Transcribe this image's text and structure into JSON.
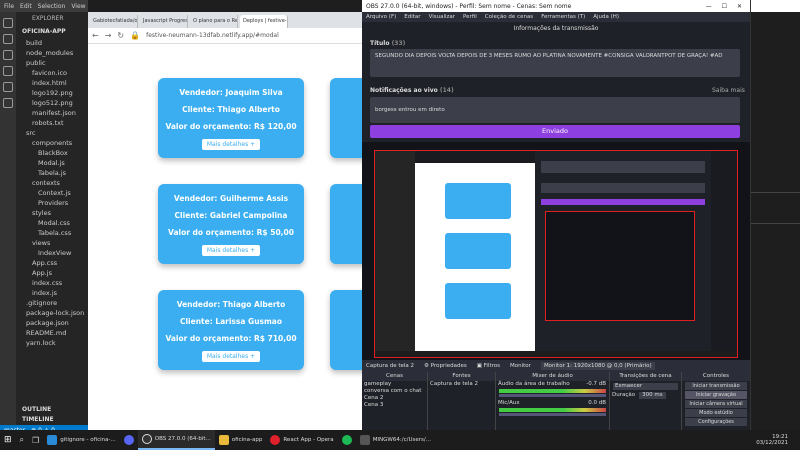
{
  "vscode": {
    "menu": [
      "File",
      "Edit",
      "Selection",
      "View"
    ],
    "explorer_header": "EXPLORER",
    "project": "OFICINA-APP",
    "tree": [
      "build",
      "node_modules",
      "public",
      "favicon.ico",
      "index.html",
      "logo192.png",
      "logo512.png",
      "manifest.json",
      "robots.txt",
      "src",
      "components",
      "BlackBox",
      "Modal.js",
      "Tabela.js",
      "contexts",
      "Context.js",
      "Providers",
      "styles",
      "Modal.css",
      "Tabela.css",
      "views",
      "IndexView",
      "App.css",
      "App.js",
      "index.css",
      "index.js",
      ".gitignore",
      "package-lock.json",
      "package.json",
      "README.md",
      "yarn.lock"
    ],
    "outline": "OUTLINE",
    "timeline": "TIMELINE",
    "status_branch": "master",
    "status_info": "⊗ 0 ⚠ 0"
  },
  "browser": {
    "tabs": [
      "Gabiotecfatiada/oficina",
      "Javascript Progress B",
      "O plano para o React",
      "Deploys | festive-neu"
    ],
    "url": "festive-neumann-13dfab.netlify.app/#modal",
    "cards": [
      {
        "vendedor": "Vendedor: Joaquim Silva",
        "cliente": "Cliente: Thiago Alberto",
        "valor": "Valor do orçamento: R$ 120,00",
        "btn": "Mais detalhes +"
      },
      {
        "vendedor": "Vendedor: Guilherme Assis",
        "cliente": "Cliente: Gabriel Campolina",
        "valor": "Valor do orçamento: R$ 50,00",
        "btn": "Mais detalhes +"
      },
      {
        "vendedor": "Vendedor: Thiago Alberto",
        "cliente": "Cliente: Larissa Gusmao",
        "valor": "Valor do orçamento: R$ 710,00",
        "btn": "Mais detalhes +"
      }
    ]
  },
  "obs": {
    "window_title": "OBS 27.0.0 (64-bit, windows) - Perfil: Sem nome - Cenas: Sem nome",
    "menu": [
      "Arquivo (F)",
      "Editar",
      "Visualizar",
      "Perfil",
      "Coleção de cenas",
      "Ferramentas (T)",
      "Ajuda (H)"
    ],
    "panel_title": "Informações da transmissão",
    "titulo_label": "Título",
    "titulo_count": "(33)",
    "titulo_text": "SEGUNDO DIA DEPOIS VOLTA DEPOIS DE 3 MESES  RUMO AO PLATINA NOVAMENTE #CONSIGA VALORANTPOT DE GRAÇA! #AD",
    "notif_label": "Notificações ao vivo",
    "notif_count": "(14)",
    "notif_link": "Saiba mais",
    "notif_text": "borgess entrou em direto",
    "send_button": "Enviado",
    "source_bar": [
      "Captura de tela 2",
      "⚙ Propriedades",
      "▣ Filtros",
      "Monitor",
      "Monitor 1: 1920x1080 @ 0,0 (Primário)"
    ],
    "docks": {
      "cenas": "Cenas",
      "scenes": [
        "gameplay",
        "conversa com o chat",
        "Cena 2",
        "Cena 3"
      ],
      "fontes": "Fontes",
      "sources": [
        "Captura de tela 2"
      ],
      "mixer": "Mixer de áudio",
      "mixer_items": [
        "Áudio da área de trabalho",
        "Mic/Aux"
      ],
      "mixer_levels": [
        "-0.7 dB",
        "0.0 dB"
      ],
      "transicoes": "Transições de cena",
      "transition": "Esmaecer",
      "duracao_label": "Duração",
      "duracao": "300 ms",
      "controles": "Controles",
      "controls": [
        "Iniciar transmissão",
        "Iniciar gravação",
        "Iniciar câmera virtual",
        "Modo estúdio",
        "Configurações"
      ]
    }
  },
  "taskbar": {
    "items": [
      "gitignore - oficina-...",
      "OBS 27.0.0 (64-bit...",
      "oficina-app",
      "React App - Opera",
      "MINGW64:/c/Users/..."
    ],
    "time": "19:21",
    "date": "03/12/2021"
  },
  "colors": {
    "card": "#3aaef0",
    "obs_accent": "#8e3fe0",
    "vscode_status": "#007acc"
  }
}
